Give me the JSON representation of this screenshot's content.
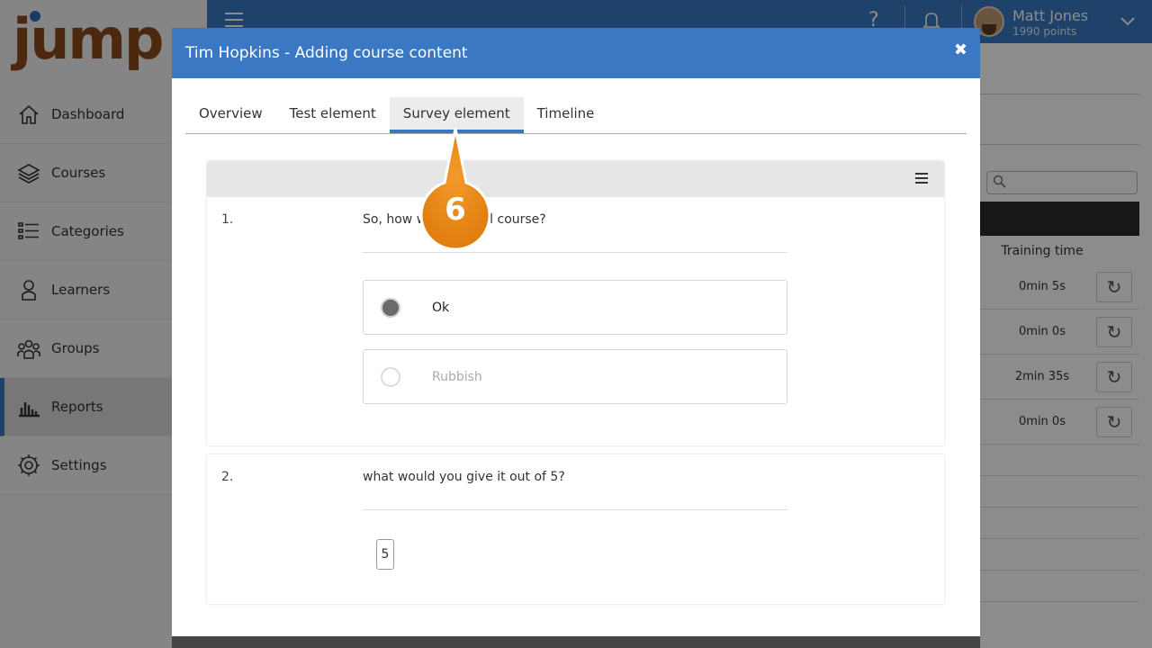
{
  "app": {
    "logo_text": "jump",
    "nav": [
      {
        "label": "Dashboard",
        "icon": "home-icon"
      },
      {
        "label": "Courses",
        "icon": "layers-icon"
      },
      {
        "label": "Categories",
        "icon": "list-icon"
      },
      {
        "label": "Learners",
        "icon": "person-icon"
      },
      {
        "label": "Groups",
        "icon": "group-icon"
      },
      {
        "label": "Reports",
        "icon": "bar-chart-icon",
        "active": true
      },
      {
        "label": "Settings",
        "icon": "gear-icon"
      }
    ],
    "user": {
      "name": "Matt Jones",
      "points": "1990 points"
    },
    "report_table": {
      "column_header": "Training time",
      "rows": [
        {
          "training_time": "0min 5s"
        },
        {
          "training_time": "0min 0s"
        },
        {
          "training_time": "2min 35s"
        },
        {
          "training_time": "0min 0s"
        }
      ]
    },
    "colors": {
      "brand_blue": "#3a78c4",
      "logo_brown": "#8b4a1c"
    }
  },
  "modal": {
    "title": "Tim Hopkins - Adding course content",
    "close_symbol": "✖",
    "tabs": [
      {
        "label": "Overview"
      },
      {
        "label": "Test element"
      },
      {
        "label": "Survey element",
        "active": true
      },
      {
        "label": "Timeline"
      }
    ],
    "questions": [
      {
        "number": "1.",
        "text": "So, how w",
        "text_end": "l course?",
        "options": [
          {
            "label": "Ok",
            "selected": true
          },
          {
            "label": "Rubbish",
            "selected": false
          }
        ]
      },
      {
        "number": "2.",
        "text": "what would you give it out of 5?",
        "answer": "5"
      }
    ]
  },
  "callout": {
    "step": "6"
  }
}
